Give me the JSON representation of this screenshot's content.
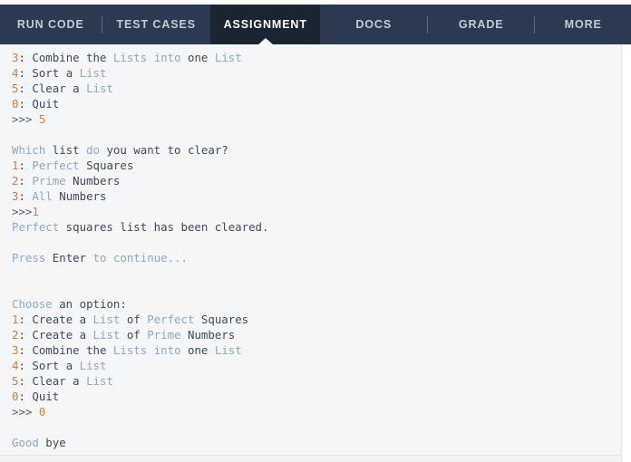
{
  "tabs": [
    {
      "id": "run-code",
      "label": "RUN CODE",
      "active": false
    },
    {
      "id": "test-cases",
      "label": "TEST CASES",
      "active": false
    },
    {
      "id": "assignment",
      "label": "ASSIGNMENT",
      "active": true
    },
    {
      "id": "docs",
      "label": "DOCS",
      "active": false
    },
    {
      "id": "grade",
      "label": "GRADE",
      "active": false
    },
    {
      "id": "more",
      "label": "MORE",
      "active": false
    }
  ],
  "colors": {
    "tabbar_bg": "#2b3a50",
    "tab_active_bg": "#1b2532",
    "console_bg": "#f5f6f8",
    "text": "#3f4a5a",
    "number": "#cf7f46",
    "keyword": "#8fa6c4"
  },
  "console": {
    "lines": [
      "3: Combine the Lists into one List",
      "4: Sort a List",
      "5: Clear a List",
      "0: Quit",
      ">>> 5",
      "",
      "Which list do you want to clear?",
      "1: Perfect Squares",
      "2: Prime Numbers",
      "3: All Numbers",
      ">>>1",
      "Perfect squares list has been cleared.",
      "",
      "Press Enter to continue...",
      "",
      "",
      "Choose an option:",
      "1: Create a List of Perfect Squares",
      "2: Create a List of Prime Numbers",
      "3: Combine the Lists into one List",
      "4: Sort a List",
      "5: Clear a List",
      "0: Quit",
      ">>> 0",
      "",
      "Good bye"
    ],
    "l0_num": "3",
    "l0_a": ": ",
    "l0_kw1": "Combine",
    "l0_b": " the ",
    "l0_kw2": "Lists",
    "l0_c": " ",
    "l0_kw3": "into",
    "l0_d": " one ",
    "l0_kw4": "List",
    "l1_num": "4",
    "l1_a": ": ",
    "l1_kw1": "Sort",
    "l1_b": " a ",
    "l1_kw2": "List",
    "l2_num": "5",
    "l2_a": ": ",
    "l2_kw1": "Clear",
    "l2_b": " a ",
    "l2_kw2": "List",
    "l3_num": "0",
    "l3_a": ": ",
    "l3_kw1": "Quit",
    "l4_pr": ">>> ",
    "l4_num": "5",
    "l6_kw1": "Which",
    "l6_a": " list ",
    "l6_kw2": "do",
    "l6_b": " you want to clear?",
    "l7_num": "1",
    "l7_a": ": ",
    "l7_kw1": "Perfect",
    "l7_b": " Squares",
    "l8_num": "2",
    "l8_a": ": ",
    "l8_kw1": "Prime",
    "l8_b": " Numbers",
    "l9_num": "3",
    "l9_a": ": ",
    "l9_kw1": "All",
    "l9_b": " Numbers",
    "l10_pr": ">>>",
    "l10_num": "1",
    "l11_kw1": "Perfect",
    "l11_a": " squares list has been cleared.",
    "l13_kw1": "Press",
    "l13_a": " Enter ",
    "l13_kw2": "to",
    "l13_b": " ",
    "l13_kw3": "continue...",
    "l16_kw1": "Choose",
    "l16_a": " an option:",
    "l17_num": "1",
    "l17_a": ": ",
    "l17_kw1": "Create",
    "l17_b": " a ",
    "l17_kw2": "List",
    "l17_c": " of ",
    "l17_kw3": "Perfect",
    "l17_d": " Squares",
    "l18_num": "2",
    "l18_a": ": ",
    "l18_kw1": "Create",
    "l18_b": " a ",
    "l18_kw2": "List",
    "l18_c": " of ",
    "l18_kw3": "Prime",
    "l18_d": " Numbers",
    "l19_num": "3",
    "l19_a": ": ",
    "l19_kw1": "Combine",
    "l19_b": " the ",
    "l19_kw2": "Lists",
    "l19_c": " ",
    "l19_kw3": "into",
    "l19_d": " one ",
    "l19_kw4": "List",
    "l20_num": "4",
    "l20_a": ": ",
    "l20_kw1": "Sort",
    "l20_b": " a ",
    "l20_kw2": "List",
    "l21_num": "5",
    "l21_a": ": ",
    "l21_kw1": "Clear",
    "l21_b": " a ",
    "l21_kw2": "List",
    "l22_num": "0",
    "l22_a": ": ",
    "l22_kw1": "Quit",
    "l23_pr": ">>> ",
    "l23_num": "0",
    "l25_kw1": "Good",
    "l25_a": " bye"
  }
}
